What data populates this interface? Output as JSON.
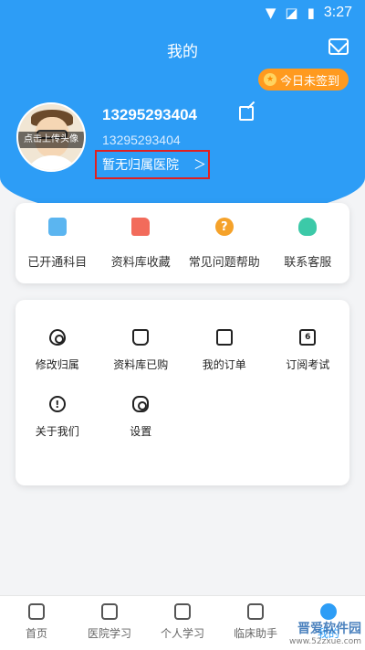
{
  "status_bar": {
    "time": "3:27"
  },
  "header": {
    "title": "我的",
    "signin_label": "今日未签到"
  },
  "profile": {
    "avatar_label": "点击上传头像",
    "name": "13295293404",
    "account": "13295293404",
    "hospital_label": "暂无归属医院"
  },
  "quick_actions": [
    {
      "label": "已开通科目",
      "icon": "book-icon"
    },
    {
      "label": "资料库收藏",
      "icon": "folder-star-icon"
    },
    {
      "label": "常见问题帮助",
      "icon": "help-icon"
    },
    {
      "label": "联系客服",
      "icon": "headset-icon"
    }
  ],
  "menu_grid": [
    {
      "label": "修改归属",
      "icon": "location-icon"
    },
    {
      "label": "资料库已购",
      "icon": "bag-icon"
    },
    {
      "label": "我的订单",
      "icon": "wallet-icon"
    },
    {
      "label": "订阅考试",
      "icon": "calendar-icon",
      "glyph": "6"
    },
    {
      "label": "关于我们",
      "icon": "info-icon",
      "glyph": "!"
    },
    {
      "label": "设置",
      "icon": "gear-icon"
    }
  ],
  "tabbar": [
    {
      "label": "首页",
      "icon": "home-icon"
    },
    {
      "label": "医院学习",
      "icon": "monitor-icon"
    },
    {
      "label": "个人学习",
      "icon": "book-open-icon"
    },
    {
      "label": "临床助手",
      "icon": "doctor-icon"
    },
    {
      "label": "我的",
      "icon": "user-icon",
      "active": true
    }
  ],
  "watermark": {
    "line1": "晋爱软件园",
    "line2": "www.52zxue.com"
  },
  "colors": {
    "primary": "#2d9df6",
    "signin": "#ff9a1f",
    "highlight_border": "#e02020"
  }
}
